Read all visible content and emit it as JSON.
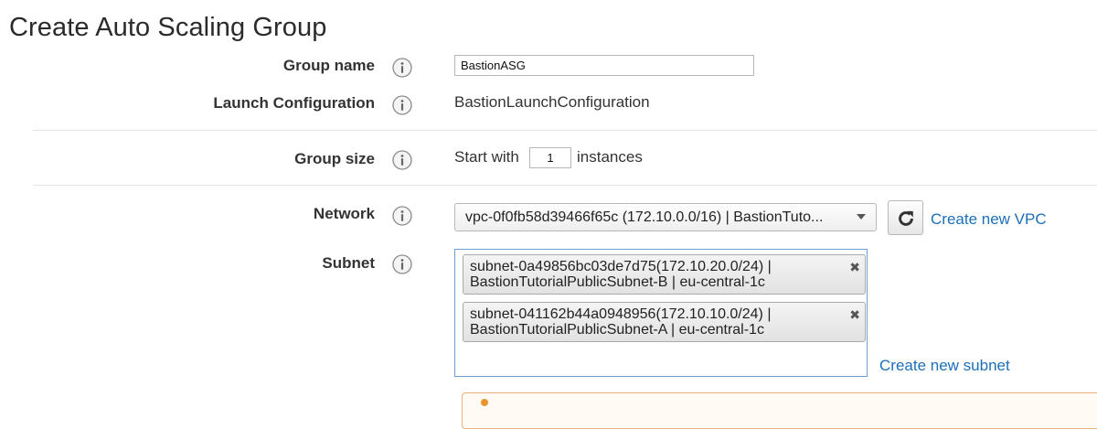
{
  "page": {
    "title": "Create Auto Scaling Group"
  },
  "fields": {
    "group_name": {
      "label": "Group name",
      "value": "BastionASG"
    },
    "launch_configuration": {
      "label": "Launch Configuration",
      "value": "BastionLaunchConfiguration"
    },
    "group_size": {
      "label": "Group size",
      "prefix": "Start with",
      "value": "1",
      "suffix": "instances"
    },
    "network": {
      "label": "Network",
      "selected": "vpc-0f0fb58d39466f65c (172.10.0.0/16) | BastionTuto...",
      "create_link": "Create new VPC"
    },
    "subnet": {
      "label": "Subnet",
      "chips": [
        {
          "line1": "subnet-0a49856bc03de7d75(172.10.20.0/24) |",
          "line2": "BastionTutorialPublicSubnet-B | eu-central-1c"
        },
        {
          "line1": "subnet-041162b44a0948956(172.10.10.0/24) |",
          "line2": "BastionTutorialPublicSubnet-A | eu-central-1c"
        }
      ],
      "remove_glyph": "✖",
      "create_link": "Create new subnet"
    }
  },
  "icons": {
    "info": "info-icon",
    "refresh": "refresh-icon",
    "caret": "chevron-down-icon",
    "alert": "warning-icon"
  },
  "colors": {
    "link": "#1d6fb8",
    "focus_border": "#6f9ed6",
    "alert_border": "#e8b27a"
  }
}
